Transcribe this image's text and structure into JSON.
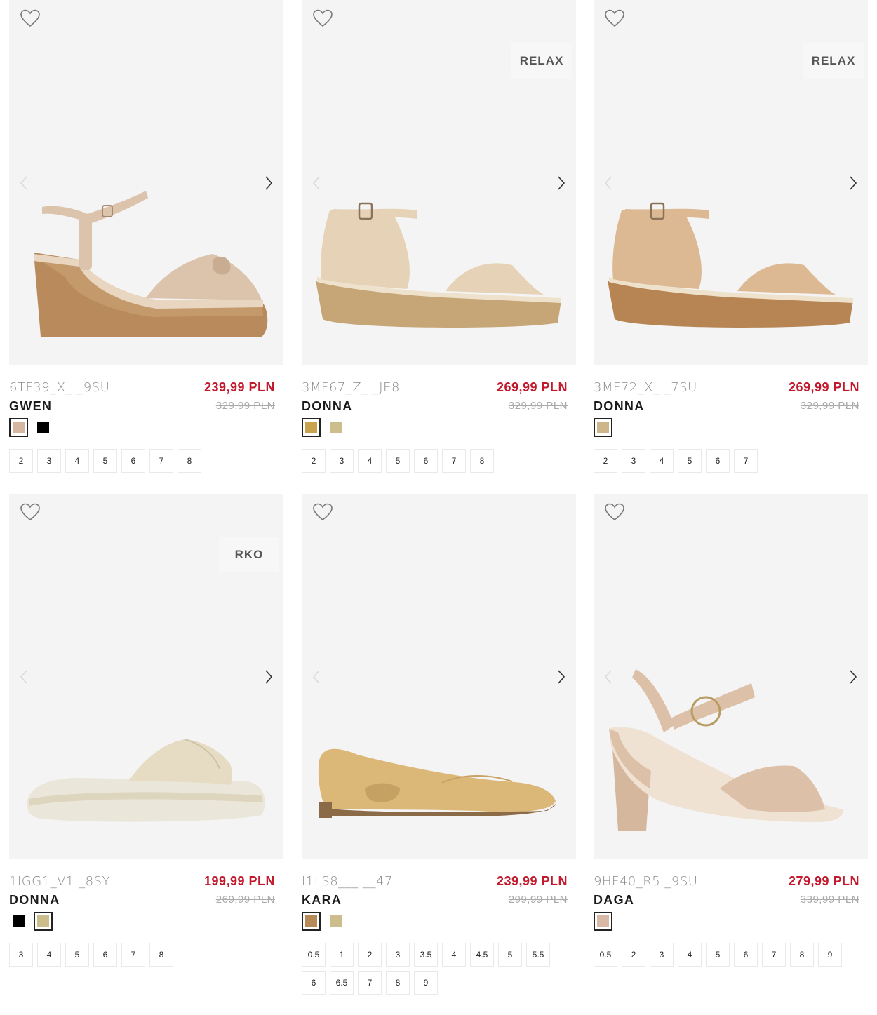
{
  "products": [
    {
      "code": "6TF39_X_ _9SU",
      "name": "GWEN",
      "price": "239,99 PLN",
      "old_price": "329,99 PLN",
      "badge": "",
      "colors": [
        "#d6b7a1",
        "#000000"
      ],
      "active_color": 0,
      "sizes": [
        "2",
        "3",
        "4",
        "5",
        "6",
        "7",
        "8"
      ],
      "shoe_style": "wedge-knot",
      "shoe_colors": {
        "upper": "#dcc3ac",
        "sole": "#b98a5b"
      }
    },
    {
      "code": "3MF67_Z_ _JE8",
      "name": "DONNA",
      "price": "269,99 PLN",
      "old_price": "329,99 PLN",
      "badge": "RELAX",
      "colors": [
        "#c9a24e",
        "#cbbd8c"
      ],
      "active_color": 0,
      "sizes": [
        "2",
        "3",
        "4",
        "5",
        "6",
        "7",
        "8"
      ],
      "shoe_style": "wedge-strap",
      "shoe_colors": {
        "upper": "#e6d2b6",
        "sole": "#c6a576"
      }
    },
    {
      "code": "3MF72_X_ _7SU",
      "name": "DONNA",
      "price": "269,99 PLN",
      "old_price": "329,99 PLN",
      "badge": "RELAX",
      "colors": [
        "#cdb689"
      ],
      "active_color": 0,
      "sizes": [
        "2",
        "3",
        "4",
        "5",
        "6",
        "7"
      ],
      "shoe_style": "wedge-strap",
      "shoe_colors": {
        "upper": "#ddb993",
        "sole": "#b68553"
      }
    },
    {
      "code": "1IGG1_V1 _8SY",
      "name": "DONNA",
      "price": "199,99 PLN",
      "old_price": "269,99 PLN",
      "badge": "RKO",
      "colors": [
        "#000000",
        "#cbbd8c"
      ],
      "active_color": 1,
      "sizes": [
        "3",
        "4",
        "5",
        "6",
        "7",
        "8"
      ],
      "shoe_style": "slide",
      "shoe_colors": {
        "upper": "#e6dcc4",
        "sole": "#eae6d9"
      }
    },
    {
      "code": "I1LS8___ __47",
      "name": "KARA",
      "price": "239,99 PLN",
      "old_price": "299,99 PLN",
      "badge": "",
      "colors": [
        "#b78a57",
        "#cbbd8c"
      ],
      "active_color": 0,
      "sizes": [
        "0.5",
        "1",
        "2",
        "3",
        "3.5",
        "4",
        "4.5",
        "5",
        "5.5",
        "6",
        "6.5",
        "7",
        "8",
        "9"
      ],
      "shoe_style": "flat",
      "shoe_colors": {
        "upper": "#dcb878",
        "sole": "#8b6a48"
      }
    },
    {
      "code": "9HF40_R5 _9SU",
      "name": "DAGA",
      "price": "279,99 PLN",
      "old_price": "339,99 PLN",
      "badge": "",
      "colors": [
        "#d8b9a5"
      ],
      "active_color": 0,
      "sizes": [
        "0.5",
        "2",
        "3",
        "4",
        "5",
        "6",
        "7",
        "8",
        "9"
      ],
      "shoe_style": "heel",
      "shoe_colors": {
        "upper": "#dcc0a8",
        "sole": "#d4b79c"
      }
    }
  ]
}
